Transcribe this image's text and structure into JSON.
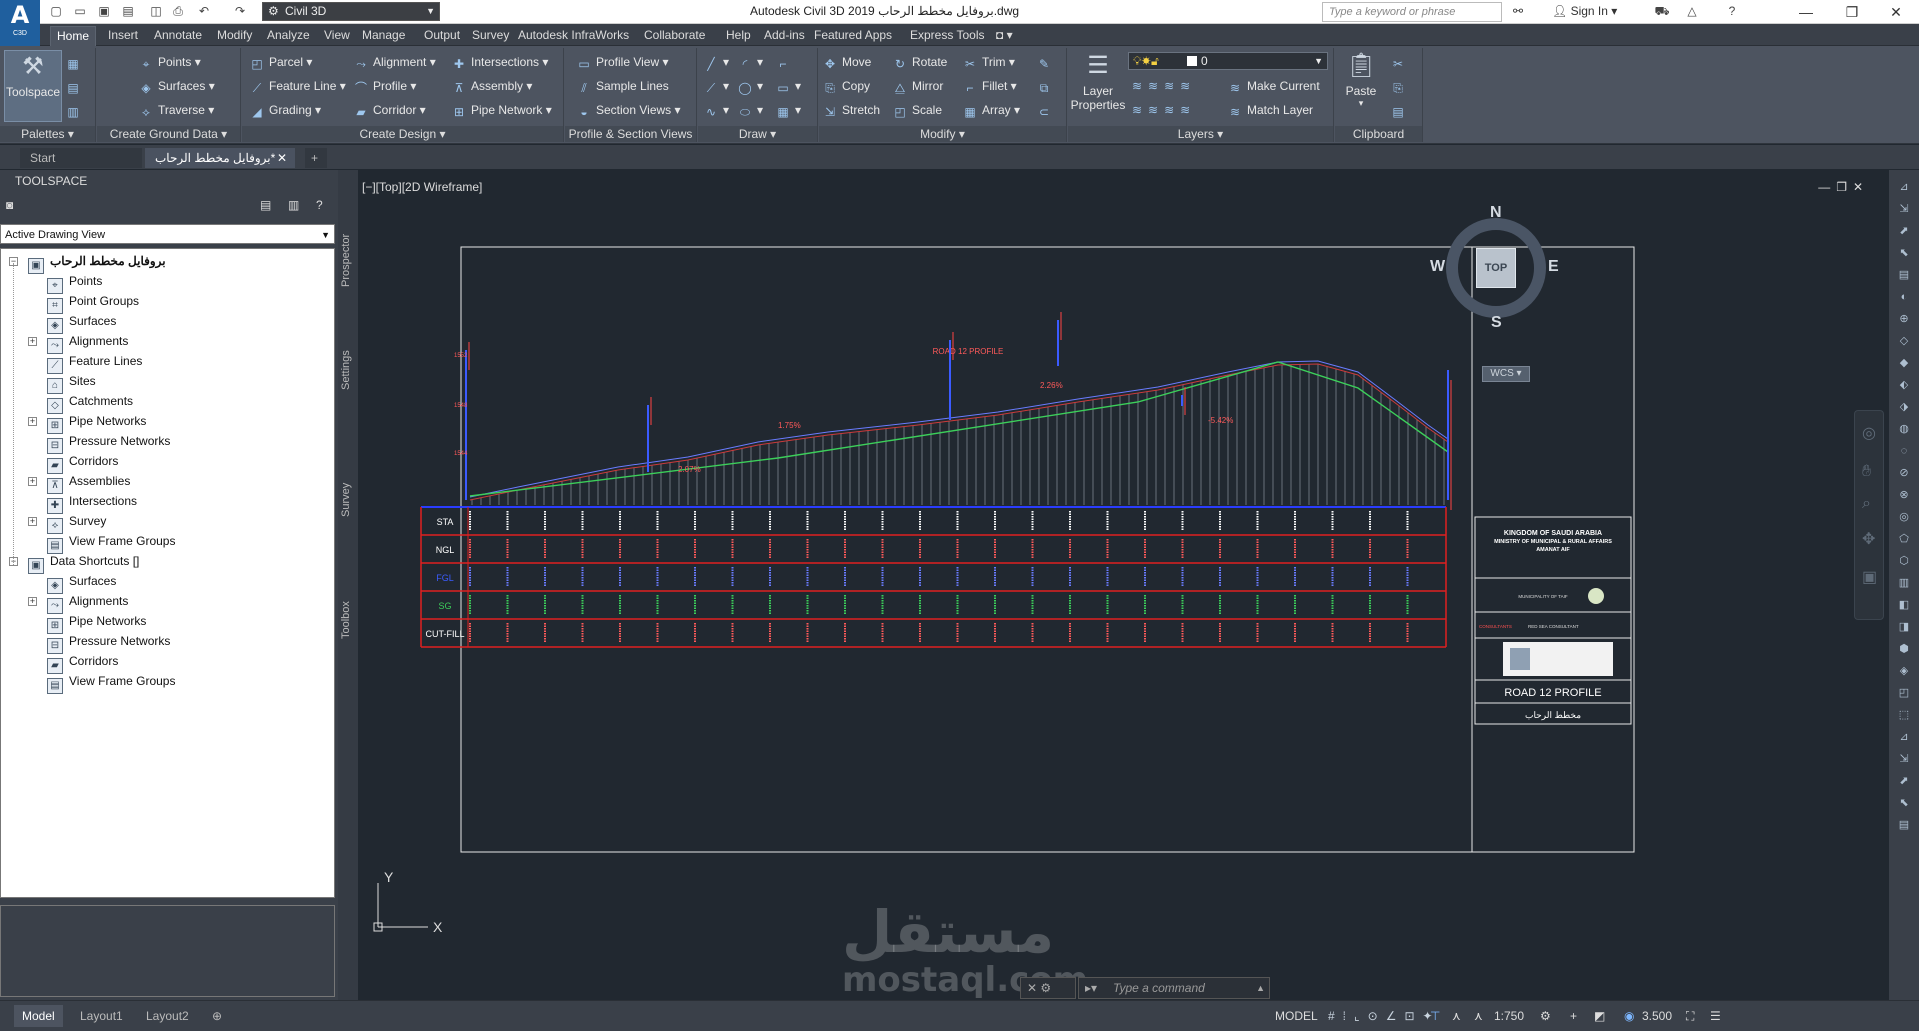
{
  "titlebar": {
    "workspace": "Civil 3D",
    "title": "Autodesk Civil 3D 2019    بروفايل مخطط الرحاب.dwg",
    "search_placeholder": "Type a keyword or phrase",
    "signin": "Sign In",
    "logo_letter": "A",
    "logo_sub": "C3D"
  },
  "menu": {
    "tabs": [
      "Home",
      "Insert",
      "Annotate",
      "Modify",
      "Analyze",
      "View",
      "Manage",
      "Output",
      "Survey",
      "Autodesk InfraWorks",
      "Collaborate",
      "Help",
      "Add-ins",
      "Featured Apps",
      "Express Tools"
    ],
    "active": "Home"
  },
  "ribbon": {
    "palettes": {
      "big": "Toolspace",
      "title": "Palettes"
    },
    "ground": {
      "items": [
        "Points",
        "Surfaces",
        "Traverse"
      ],
      "title": "Create Ground Data"
    },
    "design": {
      "items": [
        "Parcel",
        "Feature Line",
        "Grading",
        "Alignment",
        "Profile",
        "Corridor",
        "Intersections",
        "Assembly",
        "Pipe Network"
      ],
      "title": "Create Design"
    },
    "profile": {
      "items": [
        "Profile View",
        "Sample Lines",
        "Section Views"
      ],
      "title": "Profile & Section Views"
    },
    "draw": {
      "title": "Draw"
    },
    "modify": {
      "items": [
        "Move",
        "Copy",
        "Stretch",
        "Rotate",
        "Mirror",
        "Scale",
        "Trim",
        "Fillet",
        "Array"
      ],
      "title": "Modify"
    },
    "layers": {
      "big": "Layer Properties",
      "layer_value": "0",
      "items": [
        "Make Current",
        "Match Layer"
      ],
      "title": "Layers"
    },
    "clipboard": {
      "big": "Paste",
      "title": "Clipboard"
    }
  },
  "doctabs": {
    "start": "Start",
    "current": "بروفايل مخطط الرحاب*"
  },
  "toolspace": {
    "header": "TOOLSPACE",
    "view": "Active Drawing View",
    "root": "بروفايل مخطط الرحاب",
    "items": [
      "Points",
      "Point Groups",
      "Surfaces",
      "Alignments",
      "Feature Lines",
      "Sites",
      "Catchments",
      "Pipe Networks",
      "Pressure Networks",
      "Corridors",
      "Assemblies",
      "Intersections",
      "Survey",
      "View Frame Groups"
    ],
    "shortcuts_root": "Data Shortcuts []",
    "shortcuts": [
      "Surfaces",
      "Alignments",
      "Pipe Networks",
      "Pressure Networks",
      "Corridors",
      "View Frame Groups"
    ],
    "side_tabs": [
      "Prospector",
      "Settings",
      "Survey",
      "Toolbox"
    ]
  },
  "viewport": {
    "label": "[−][Top][2D Wireframe]",
    "compass": {
      "n": "N",
      "s": "S",
      "e": "E",
      "w": "W",
      "cube": "TOP",
      "ucs": "WCS"
    },
    "ucs_x": "X",
    "ucs_y": "Y"
  },
  "drawing": {
    "profile_title": "ROAD 12 PROFILE",
    "grade_labels": [
      "2.07%",
      "1.75%",
      "2.26%",
      "-5.42%"
    ],
    "elev_labels": [
      "1552",
      "1548",
      "1544"
    ],
    "row_labels": [
      "STA",
      "NGL",
      "FGL",
      "SG",
      "CUT-FILL"
    ],
    "titleblock": {
      "org": "KINGDOM OF SAUDI ARABIA\nMINISTRY OF MUNICIPAL & RURAL AFFAIRS\nAMANAT AIF",
      "municipality": "MUNICIPALITY OF TAIF",
      "consultant_label": "CONSULTANTS",
      "consultant": "RED SEA CONSULTANT",
      "drawing_title": "ROAD 12 PROFILE",
      "project": "مخطط الرحاب"
    }
  },
  "command": {
    "placeholder": "Type a command"
  },
  "watermark": {
    "ar": "مستقل",
    "en": "mostaql.com"
  },
  "statusbar": {
    "layouts": [
      "Model",
      "Layout1",
      "Layout2"
    ],
    "model": "MODEL",
    "scale": "1:750",
    "value": "3.500"
  }
}
